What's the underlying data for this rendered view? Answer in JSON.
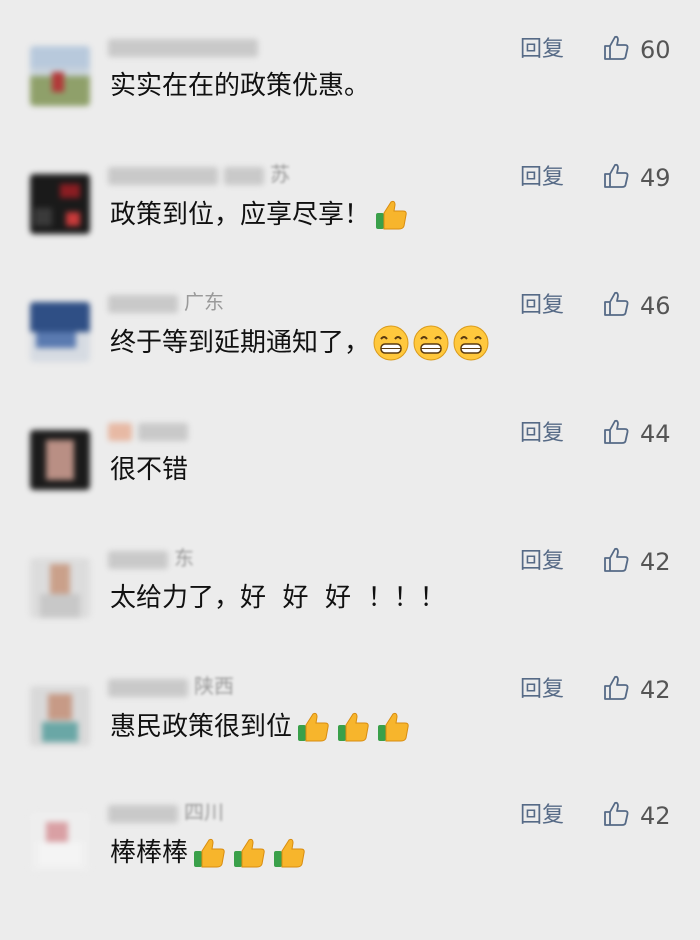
{
  "comments": [
    {
      "location": "",
      "text": "实实在在的政策优惠。",
      "reply_label": "回复",
      "likes": "60",
      "emojis": []
    },
    {
      "location": "苏",
      "text": "政策到位，应享尽享！",
      "reply_label": "回复",
      "likes": "49",
      "emojis": [
        "thumbs-up"
      ]
    },
    {
      "location": "广东",
      "text": "终于等到延期通知了，",
      "reply_label": "回复",
      "likes": "46",
      "emojis": [
        "grin",
        "grin",
        "grin"
      ]
    },
    {
      "location": "",
      "text": "很不错",
      "reply_label": "回复",
      "likes": "44",
      "emojis": []
    },
    {
      "location": "东",
      "text": "太给力了，好  好  好  ！！！",
      "reply_label": "回复",
      "likes": "42",
      "emojis": []
    },
    {
      "location": "陕西",
      "text": "惠民政策很到位",
      "reply_label": "回复",
      "likes": "42",
      "emojis": [
        "thumbs-up",
        "thumbs-up",
        "thumbs-up"
      ]
    },
    {
      "location": "四川",
      "text": "棒棒棒",
      "reply_label": "回复",
      "likes": "42",
      "emojis": [
        "thumbs-up",
        "thumbs-up",
        "thumbs-up"
      ]
    }
  ],
  "icons": {
    "like": "thumbs-up-outline-icon"
  },
  "colors": {
    "background": "#ececec",
    "reply_link": "#566a86",
    "location": "#9a9a9a"
  }
}
